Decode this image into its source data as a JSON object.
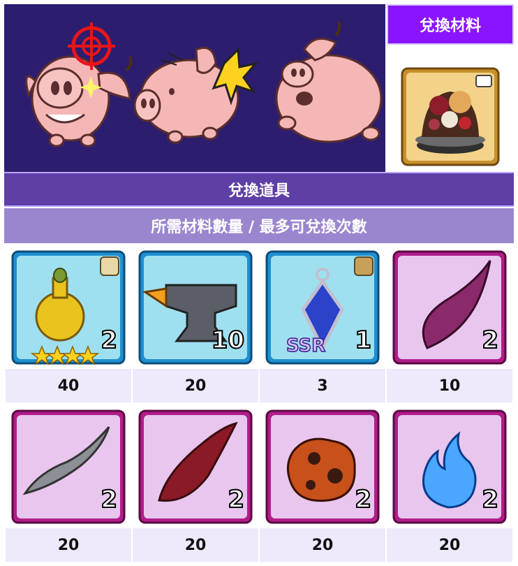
{
  "material_header": "兌換材料",
  "exchange_item_header": "兌換道具",
  "quantity_header": "所需材料數量 / 最多可兌換次數",
  "colors": {
    "banner_bg": "#2d1d6e",
    "material_header_bg": "#8b14ff",
    "header1_bg": "#5e3fa6",
    "header2_bg": "#9a86cf",
    "count_bg": "#eee9fb"
  },
  "items": [
    {
      "name": "golden-elixir-icon",
      "qty": "2",
      "count": "40",
      "frame": "blue",
      "stars": 4
    },
    {
      "name": "anvil-icon",
      "qty": "10",
      "count": "20",
      "frame": "blue"
    },
    {
      "name": "blue-gem-pendant-icon",
      "qty": "1",
      "count": "3",
      "frame": "blue",
      "badge": "SSR"
    },
    {
      "name": "pink-horn-icon",
      "qty": "2",
      "count": "10",
      "frame": "pink"
    },
    {
      "name": "gray-wing-icon",
      "qty": "2",
      "count": "20",
      "frame": "pink"
    },
    {
      "name": "red-claw-icon",
      "qty": "2",
      "count": "20",
      "frame": "pink"
    },
    {
      "name": "magma-rock-icon",
      "qty": "2",
      "count": "20",
      "frame": "pink"
    },
    {
      "name": "blue-flame-icon",
      "qty": "2",
      "count": "20",
      "frame": "pink"
    }
  ]
}
